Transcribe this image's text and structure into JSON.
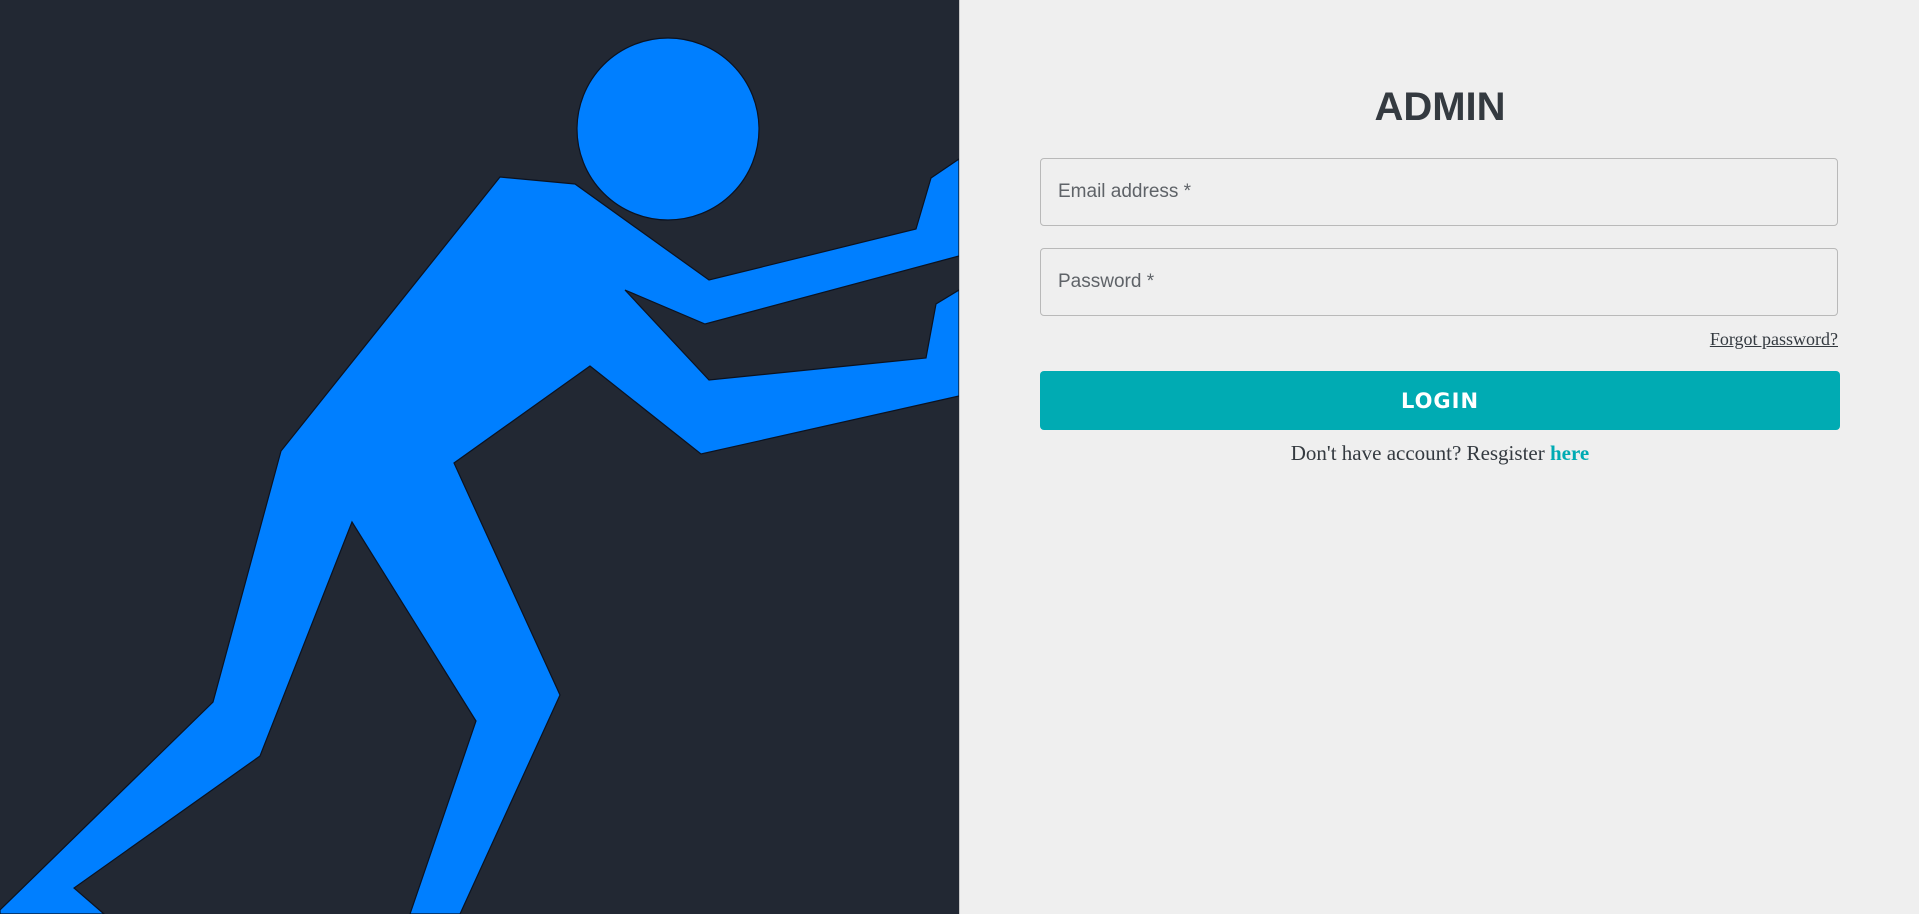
{
  "login": {
    "title": "ADMIN",
    "email_placeholder": "Email address *",
    "password_placeholder": "Password *",
    "forgot_password": "Forgot password?",
    "login_button": "LOGIN",
    "register_prompt": "Don't have account? Resgister ",
    "register_link": "here"
  },
  "colors": {
    "hero_background": "#222833",
    "figure": "#007fff",
    "accent": "#00abb3",
    "panel_background": "#efefef",
    "text": "#343a40"
  },
  "icons": {
    "hero_illustration": "pushing-figure-illustration"
  }
}
